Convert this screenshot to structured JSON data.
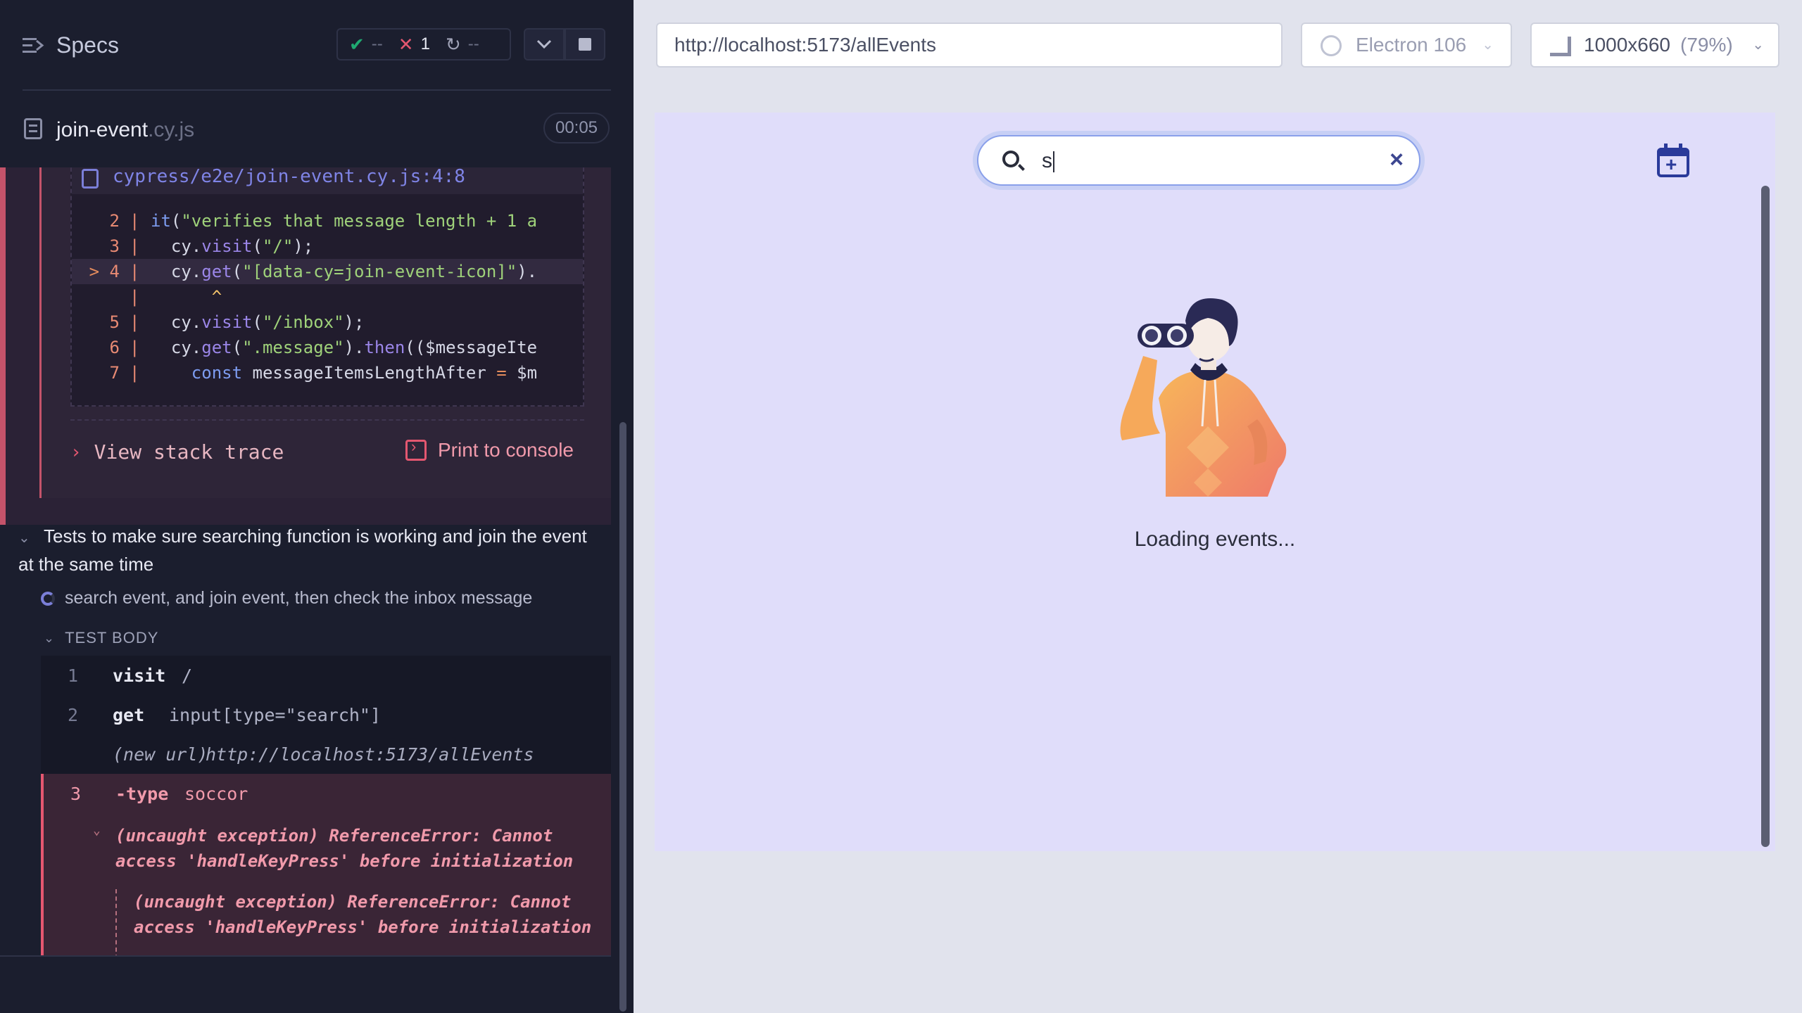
{
  "reporter": {
    "specs_label": "Specs",
    "stats": {
      "passed": "--",
      "failed": "1",
      "pending": "--"
    },
    "spec": {
      "name": "join-event",
      "ext": ".cy.js",
      "duration": "00:05"
    },
    "error": {
      "file": "cypress/e2e/join-event.cy.js:4:8",
      "code_lines": [
        {
          "num": "2",
          "marker": "",
          "text": "it(\"verifies that message length + 1 a"
        },
        {
          "num": "3",
          "marker": "",
          "text": "  cy.visit(\"/\");"
        },
        {
          "num": "4",
          "marker": ">",
          "text": "  cy.get(\"[data-cy=join-event-icon]\")."
        },
        {
          "num": "",
          "marker": "",
          "text": "      ^"
        },
        {
          "num": "5",
          "marker": "",
          "text": "  cy.visit(\"/inbox\");"
        },
        {
          "num": "6",
          "marker": "",
          "text": "  cy.get(\".message\").then(($messageIte"
        },
        {
          "num": "7",
          "marker": "",
          "text": "    const messageItemsLengthAfter = $m"
        }
      ],
      "view_stack_trace": "View stack trace",
      "print_to_console": "Print to console"
    },
    "suite_title": "Tests to make sure searching function is working and join the event at the same time",
    "test_title": "search event, and join event, then check the inbox message",
    "test_body_label": "TEST BODY",
    "commands": [
      {
        "num": "1",
        "name": "visit",
        "message": "/"
      },
      {
        "num": "2",
        "name": "get",
        "message": "input[type=\"search\"]"
      },
      {
        "num": "",
        "name": "(new url)",
        "message": "http://localhost:5173/allEvents"
      },
      {
        "num": "3",
        "name": "-type",
        "message": "soccor"
      }
    ],
    "exception": {
      "summary": "(uncaught exception)  ReferenceError: Cannot access 'handleKeyPress' before initialization",
      "nested": "(uncaught exception)  ReferenceError: Cannot access 'handleKeyPress' before initialization"
    }
  },
  "browser": {
    "url": "http://localhost:5173/allEvents",
    "browser_name": "Electron 106",
    "viewport": "1000x660",
    "scale": "(79%)"
  },
  "app": {
    "search_value": "s",
    "loading_text": "Loading events..."
  },
  "colors": {
    "fail": "#e45770",
    "pass": "#1fa971",
    "accent": "#7b7fd8",
    "app_bg": "#e0ddfa"
  }
}
